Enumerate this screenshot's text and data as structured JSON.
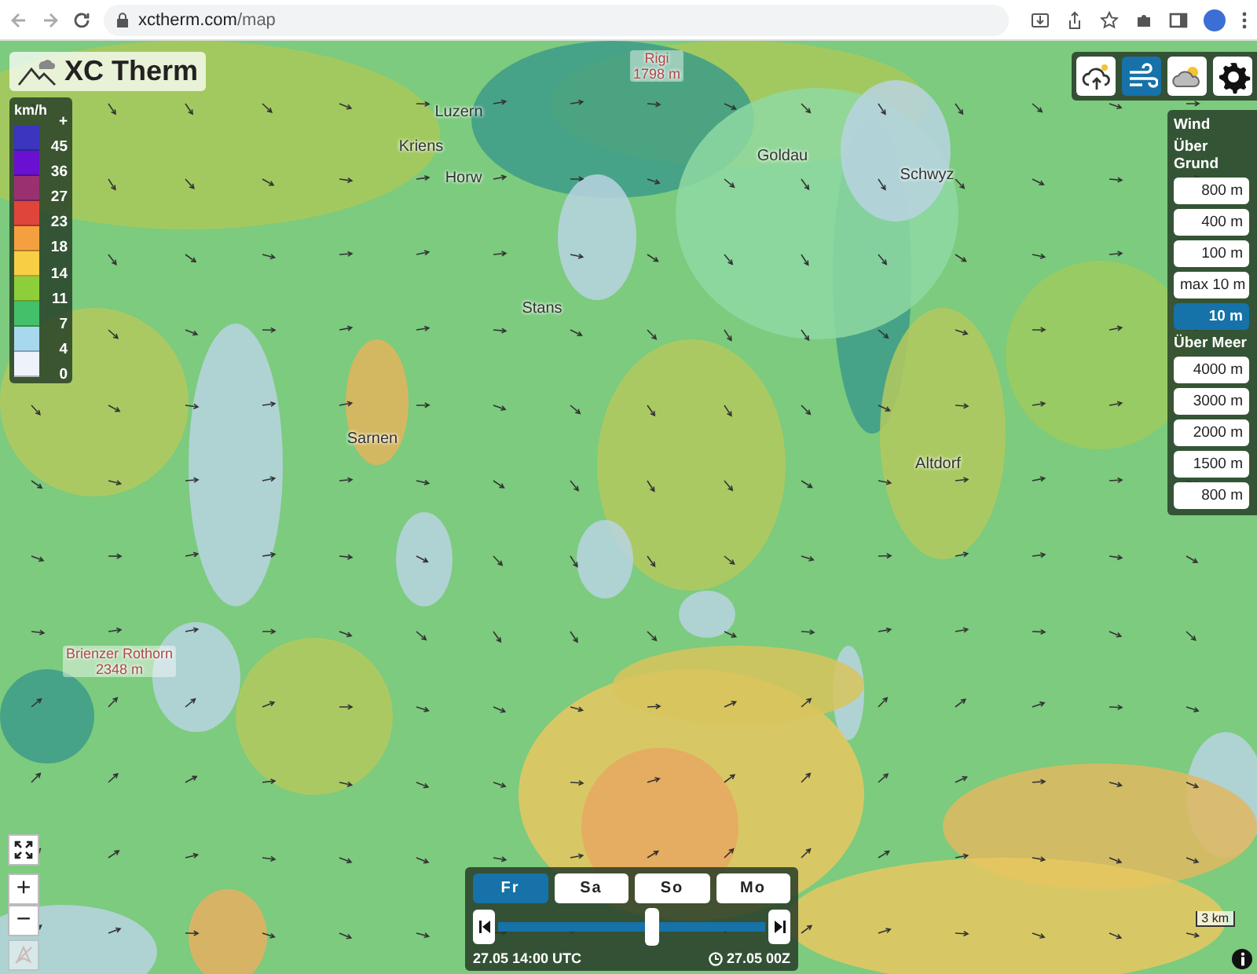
{
  "browser": {
    "url_host": "xctherm.com",
    "url_path": "/map"
  },
  "logo": {
    "text": "XC Therm"
  },
  "toolbar": [
    {
      "kind": "cloud-upload",
      "selected": false
    },
    {
      "kind": "wind",
      "selected": true
    },
    {
      "kind": "cloud-sun",
      "selected": false
    },
    {
      "kind": "settings",
      "selected": false
    }
  ],
  "legend": {
    "unit": "km/h",
    "ticks": [
      "+",
      "45",
      "36",
      "27",
      "23",
      "18",
      "14",
      "11",
      "7",
      "4",
      "0"
    ],
    "swatches": [
      {
        "color": "#3b35c0"
      },
      {
        "color": "#6a10d0"
      },
      {
        "color": "#9a3070"
      },
      {
        "color": "#e0453a"
      },
      {
        "color": "#f5a040"
      },
      {
        "color": "#f7cf45"
      },
      {
        "color": "#8ccf3a"
      },
      {
        "color": "#45c06a"
      },
      {
        "color": "#a8d8ee"
      },
      {
        "color": "#eef3fb"
      }
    ]
  },
  "places": [
    {
      "kind": "town",
      "name": "Luzern"
    },
    {
      "kind": "town",
      "name": "Kriens"
    },
    {
      "kind": "town",
      "name": "Horw"
    },
    {
      "kind": "town",
      "name": "Goldau"
    },
    {
      "kind": "town",
      "name": "Schwyz"
    },
    {
      "kind": "town",
      "name": "Stans"
    },
    {
      "kind": "town",
      "name": "Sarnen"
    },
    {
      "kind": "town",
      "name": "Altdorf"
    },
    {
      "kind": "peak",
      "name": "Rigi",
      "elevation": "1798 m"
    },
    {
      "kind": "peak",
      "name": "Brienzer Rothorn",
      "elevation": "2348 m"
    }
  ],
  "wind_panel": {
    "title": "Wind",
    "sections": [
      {
        "heading": "Über Grund",
        "options": [
          {
            "label": "800 m",
            "selected": false
          },
          {
            "label": "400 m",
            "selected": false
          },
          {
            "label": "100 m",
            "selected": false
          },
          {
            "label": "max 10 m",
            "selected": false
          },
          {
            "label": "10 m",
            "selected": true
          }
        ]
      },
      {
        "heading": "Über Meer",
        "options": [
          {
            "label": "4000 m",
            "selected": false
          },
          {
            "label": "3000 m",
            "selected": false
          },
          {
            "label": "2000 m",
            "selected": false
          },
          {
            "label": "1500 m",
            "selected": false
          },
          {
            "label": "800 m",
            "selected": false
          }
        ]
      }
    ]
  },
  "timeline": {
    "days": [
      {
        "label": "Fr",
        "selected": true
      },
      {
        "label": "Sa",
        "selected": false
      },
      {
        "label": "So",
        "selected": false
      },
      {
        "label": "Mo",
        "selected": false
      }
    ],
    "level": 0.58,
    "time": "27.05 14:00 UTC",
    "run": "27.05 00Z"
  },
  "map_controls": [
    {
      "kind": "fullscreen",
      "disabled": false
    },
    {
      "kind": "zoom-in",
      "label": "+",
      "disabled": false
    },
    {
      "kind": "zoom-out",
      "label": "−",
      "disabled": false
    },
    {
      "kind": "locate",
      "disabled": true
    }
  ],
  "scale": {
    "label": "3 km"
  }
}
